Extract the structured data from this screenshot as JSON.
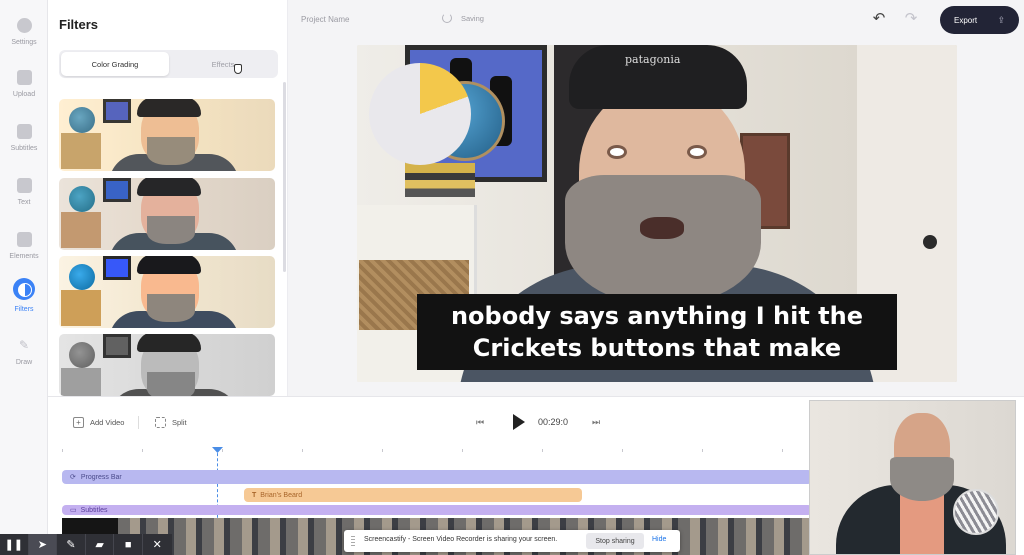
{
  "sidebar": {
    "items": [
      {
        "label": "Settings",
        "icon": "gear-icon"
      },
      {
        "label": "Upload",
        "icon": "image-icon"
      },
      {
        "label": "Subtitles",
        "icon": "subtitles-icon"
      },
      {
        "label": "Text",
        "icon": "text-icon"
      },
      {
        "label": "Elements",
        "icon": "shapes-icon"
      },
      {
        "label": "Filters",
        "icon": "filters-icon",
        "active": true
      },
      {
        "label": "Draw",
        "icon": "pencil-icon"
      }
    ]
  },
  "filters_panel": {
    "title": "Filters",
    "tabs": [
      {
        "label": "Color Grading",
        "active": true
      },
      {
        "label": "Effects",
        "active": false
      }
    ]
  },
  "topbar": {
    "project_name": "Project Name",
    "status": "Saving",
    "export_label": "Export"
  },
  "video": {
    "caption_line1": "nobody says anything I hit the",
    "caption_line2": "Crickets buttons that make",
    "cap_brand": "patagonia",
    "pie_overlay": {
      "segments": [
        {
          "color": "#f3c84b",
          "fraction": 0.19
        },
        {
          "color": "#e9e8ec",
          "fraction": 0.81
        }
      ]
    }
  },
  "timeline": {
    "add_video_label": "Add Video",
    "split_label": "Split",
    "time": "00:29:0",
    "tracks": [
      {
        "label": "Progress Bar",
        "color": "#b8b8f0"
      },
      {
        "label": "Brian's Beard",
        "color": "#f6c995"
      },
      {
        "label": "Subtitles",
        "color": "#c4b0f0"
      }
    ]
  },
  "share_bar": {
    "message": "Screencastify - Screen Video Recorder is sharing your screen.",
    "stop_label": "Stop sharing",
    "hide_label": "Hide"
  },
  "recorder_toolbar": {
    "icons": [
      "pause-icon",
      "pointer-icon",
      "pen-icon",
      "eraser-icon",
      "camera-icon",
      "close-icon"
    ],
    "glyphs": [
      "❚❚",
      "➤",
      "✎",
      "▰",
      "■",
      "✕"
    ]
  },
  "colors": {
    "accent": "#3b82f6",
    "export_bg": "#222436"
  }
}
